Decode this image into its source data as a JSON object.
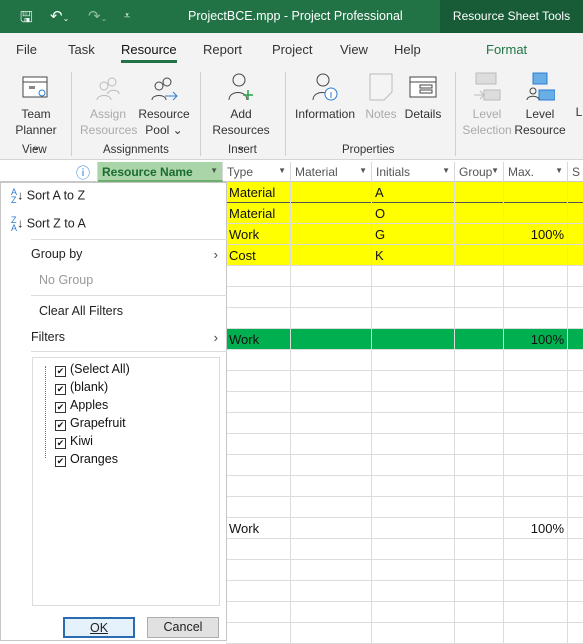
{
  "titlebar": {
    "title": "ProjectBCE.mpp  -  Project Professional",
    "context_tab": "Resource Sheet Tools"
  },
  "tabs": [
    "File",
    "Task",
    "Resource",
    "Report",
    "Project",
    "View",
    "Help",
    "Format"
  ],
  "active_tab": "Resource",
  "ribbon": {
    "team_planner": [
      "Team",
      "Planner"
    ],
    "assign_resources": [
      "Assign",
      "Resources"
    ],
    "resource_pool": [
      "Resource",
      "Pool"
    ],
    "add_resources": [
      "Add",
      "Resources"
    ],
    "information": "Information",
    "notes": "Notes",
    "details": "Details",
    "level_selection": [
      "Level",
      "Selection"
    ],
    "level_resource": [
      "Level",
      "Resource"
    ],
    "level_partial": "L",
    "groups": [
      "View",
      "Assignments",
      "Insert",
      "Properties"
    ]
  },
  "columns": [
    "Resource Name",
    "Type",
    "Material",
    "Initials",
    "Group",
    "Max.",
    "S"
  ],
  "rows": [
    {
      "type": "Material",
      "initials": "A",
      "max": "",
      "hl": "yellow"
    },
    {
      "type": "Material",
      "initials": "O",
      "max": "",
      "hl": "yellow"
    },
    {
      "type": "Work",
      "initials": "G",
      "max": "100%",
      "hl": "yellow"
    },
    {
      "type": "Cost",
      "initials": "K",
      "max": "",
      "hl": "yellow"
    },
    {
      "type": "",
      "initials": "",
      "max": "",
      "hl": ""
    },
    {
      "type": "",
      "initials": "",
      "max": "",
      "hl": ""
    },
    {
      "type": "",
      "initials": "",
      "max": "",
      "hl": ""
    },
    {
      "type": "Work",
      "initials": "",
      "max": "100%",
      "hl": "green"
    },
    {
      "type": "",
      "initials": "",
      "max": "",
      "hl": ""
    },
    {
      "type": "",
      "initials": "",
      "max": "",
      "hl": ""
    },
    {
      "type": "",
      "initials": "",
      "max": "",
      "hl": ""
    },
    {
      "type": "",
      "initials": "",
      "max": "",
      "hl": ""
    },
    {
      "type": "",
      "initials": "",
      "max": "",
      "hl": ""
    },
    {
      "type": "",
      "initials": "",
      "max": "",
      "hl": ""
    },
    {
      "type": "",
      "initials": "",
      "max": "",
      "hl": ""
    },
    {
      "type": "",
      "initials": "",
      "max": "",
      "hl": ""
    },
    {
      "type": "Work",
      "initials": "",
      "max": "100%",
      "hl": ""
    },
    {
      "type": "",
      "initials": "",
      "max": "",
      "hl": ""
    },
    {
      "type": "",
      "initials": "",
      "max": "",
      "hl": ""
    },
    {
      "type": "",
      "initials": "",
      "max": "",
      "hl": ""
    },
    {
      "type": "",
      "initials": "",
      "max": "",
      "hl": ""
    },
    {
      "type": "",
      "initials": "",
      "max": "",
      "hl": ""
    }
  ],
  "colors": {
    "yellow": "#ffff00",
    "green": "#00b050",
    "title_green": "#217346"
  },
  "menu": {
    "sort_az": "Sort A to Z",
    "sort_za": "Sort Z to A",
    "group_by": "Group by",
    "no_group": "No Group",
    "clear_filters": "Clear All Filters",
    "filters": "Filters",
    "filter_items": [
      {
        "label": "(Select All)",
        "checked": true
      },
      {
        "label": "(blank)",
        "checked": true
      },
      {
        "label": "Apples",
        "checked": true
      },
      {
        "label": "Grapefruit",
        "checked": true
      },
      {
        "label": "Kiwi",
        "checked": true
      },
      {
        "label": "Oranges",
        "checked": true
      }
    ],
    "ok": "OK",
    "cancel": "Cancel"
  }
}
